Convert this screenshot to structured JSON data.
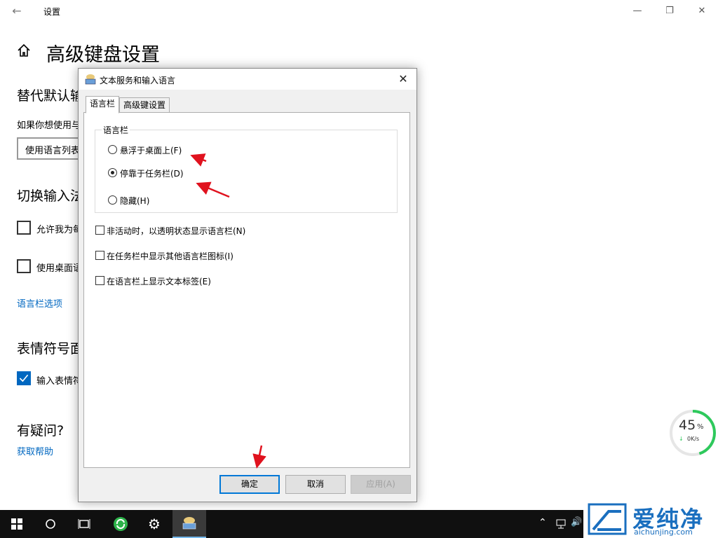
{
  "window": {
    "app_title": "设置",
    "minimize": "—",
    "restore": "❐",
    "close": "✕"
  },
  "page": {
    "title": "高级键盘设置"
  },
  "sections": {
    "default_input": {
      "heading": "替代默认输入法",
      "desc": "如果你想使用与语言列表中第一个不同的输入法",
      "dropdown_value": "使用语言列表"
    },
    "switch_input": {
      "heading": "切换输入法",
      "cb1": "允许我为每个应用窗口使用不同的输入法",
      "cb2": "使用桌面语言栏(如果可用)",
      "link": "语言栏选项"
    },
    "emoji": {
      "heading": "表情符号面板",
      "cb": "输入表情符号后不自动关闭面板"
    },
    "help": {
      "heading": "有疑问?",
      "link": "获取帮助"
    }
  },
  "dialog": {
    "title": "文本服务和输入语言",
    "close": "✕",
    "tabs": [
      "语言栏",
      "高级键设置"
    ],
    "active_tab": 0,
    "group_label": "语言栏",
    "radios": [
      {
        "label": "悬浮于桌面上(F)",
        "checked": false
      },
      {
        "label": "停靠于任务栏(D)",
        "checked": true
      },
      {
        "label": "隐藏(H)",
        "checked": false
      }
    ],
    "checkboxes": [
      {
        "label": "非活动时，以透明状态显示语言栏(N)",
        "checked": false
      },
      {
        "label": "在任务栏中显示其他语言栏图标(I)",
        "checked": false
      },
      {
        "label": "在语言栏上显示文本标签(E)",
        "checked": false
      }
    ],
    "buttons": {
      "ok": "确定",
      "cancel": "取消",
      "apply": "应用(A)"
    }
  },
  "speed_widget": {
    "percent": "45",
    "percent_unit": "%",
    "rate": "0K/s",
    "progress": 0.45
  },
  "watermark": {
    "name": "爱纯净",
    "url": "aichunjing.com"
  },
  "colors": {
    "accent": "#0067c0",
    "arrow": "#e0121e",
    "gauge": "#2ec95c"
  }
}
